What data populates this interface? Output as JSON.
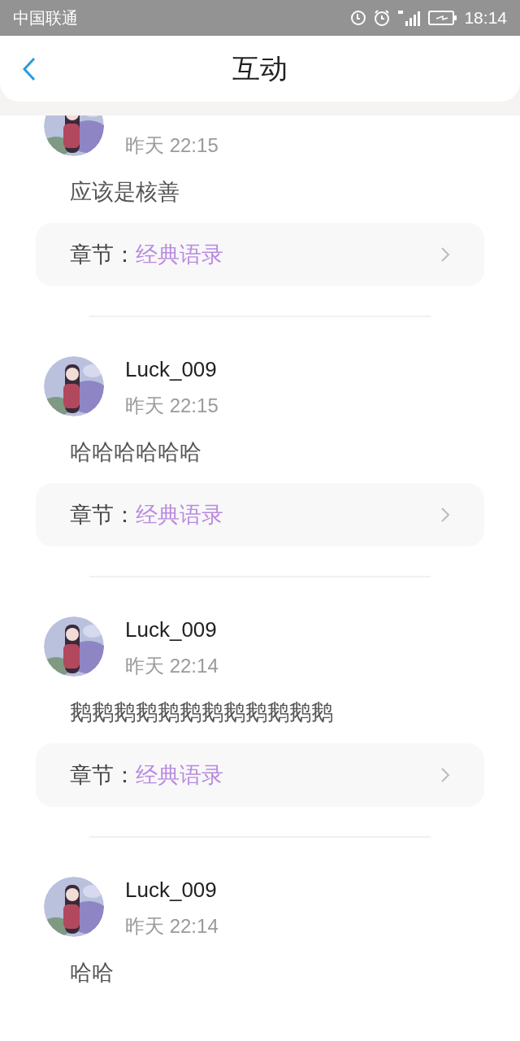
{
  "status_bar": {
    "carrier": "中国联通",
    "time": "18:14"
  },
  "header": {
    "title": "互动"
  },
  "items": [
    {
      "time": "昨天 22:15",
      "comment": "应该是核善",
      "chapter_label": "章节：",
      "chapter": "经典语录"
    },
    {
      "name": "Luck_009",
      "time": "昨天 22:15",
      "comment": "哈哈哈哈哈哈",
      "chapter_label": "章节：",
      "chapter": "经典语录"
    },
    {
      "name": "Luck_009",
      "time": "昨天 22:14",
      "comment": "鹅鹅鹅鹅鹅鹅鹅鹅鹅鹅鹅鹅",
      "chapter_label": "章节：",
      "chapter": "经典语录"
    },
    {
      "name": "Luck_009",
      "time": "昨天 22:14",
      "comment": "哈哈"
    }
  ]
}
